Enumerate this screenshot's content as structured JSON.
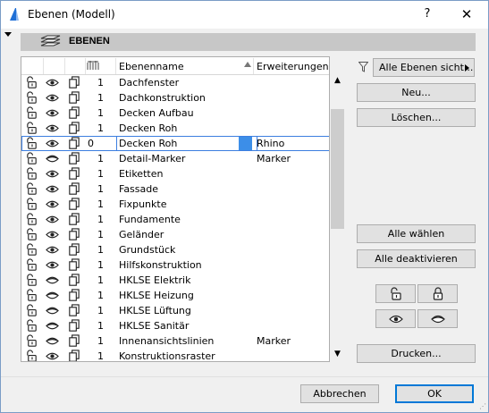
{
  "window": {
    "title": "Ebenen (Modell)",
    "help_label": "?",
    "close_label": "✕"
  },
  "header": {
    "label": "EBENEN",
    "icon": "layers-icon"
  },
  "table": {
    "columns": {
      "name": "Ebenenname",
      "extensions": "Erweiterungen"
    },
    "rows": [
      {
        "num": "1",
        "name": "Dachfenster",
        "ext": ""
      },
      {
        "num": "1",
        "name": "Dachkonstruktion",
        "ext": ""
      },
      {
        "num": "1",
        "name": "Decken Aufbau",
        "ext": ""
      },
      {
        "num": "1",
        "name": "Decken Roh",
        "ext": ""
      },
      {
        "num": "0",
        "name": "Decken Roh",
        "ext": "Rhino",
        "selected": true
      },
      {
        "num": "1",
        "name": "Detail-Marker",
        "ext": "Marker",
        "hidden": true
      },
      {
        "num": "1",
        "name": "Etiketten",
        "ext": ""
      },
      {
        "num": "1",
        "name": "Fassade",
        "ext": ""
      },
      {
        "num": "1",
        "name": "Fixpunkte",
        "ext": ""
      },
      {
        "num": "1",
        "name": "Fundamente",
        "ext": ""
      },
      {
        "num": "1",
        "name": "Geländer",
        "ext": ""
      },
      {
        "num": "1",
        "name": "Grundstück",
        "ext": ""
      },
      {
        "num": "1",
        "name": "Hilfskonstruktion",
        "ext": ""
      },
      {
        "num": "1",
        "name": "HKLSE Elektrik",
        "ext": "",
        "hidden": true
      },
      {
        "num": "1",
        "name": "HKLSE Heizung",
        "ext": "",
        "hidden": true
      },
      {
        "num": "1",
        "name": "HKLSE Lüftung",
        "ext": "",
        "hidden": true
      },
      {
        "num": "1",
        "name": "HKLSE Sanitär",
        "ext": "",
        "hidden": true
      },
      {
        "num": "1",
        "name": "Innenansichtslinien",
        "ext": "Marker",
        "hidden": true
      },
      {
        "num": "1",
        "name": "Konstruktionsraster",
        "ext": ""
      }
    ]
  },
  "sidebar": {
    "filter_dropdown": "Alle Ebenen sicht...",
    "new_button": "Neu...",
    "delete_button": "Löschen...",
    "select_all_button": "Alle wählen",
    "deselect_all_button": "Alle deaktivieren",
    "print_button": "Drucken..."
  },
  "footer": {
    "cancel_button": "Abbrechen",
    "ok_button": "OK"
  },
  "colors": {
    "selection": "#3c7ee0",
    "swatch": "#3c8ee8",
    "header_bar": "#c7c7c7"
  }
}
